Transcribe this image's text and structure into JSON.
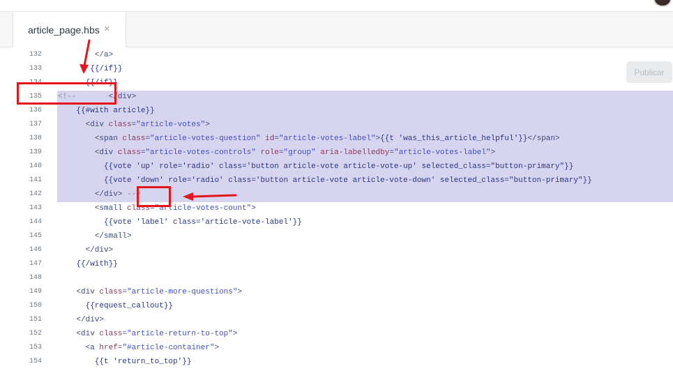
{
  "tab": {
    "filename": "article_page.hbs",
    "close_glyph": "×"
  },
  "toolbar": {
    "publish_label": "Publicar"
  },
  "editor": {
    "highlight_color": "#d7d4f0",
    "lines": [
      {
        "n": "132",
        "indent": 8,
        "tokens": [
          [
            "tag",
            "</a>"
          ]
        ]
      },
      {
        "n": "133",
        "indent": 7,
        "tokens": [
          [
            "hb",
            "{{/if}}"
          ]
        ]
      },
      {
        "n": "134",
        "indent": 6,
        "tokens": [
          [
            "hb",
            "{{/if}}"
          ]
        ]
      },
      {
        "n": "135",
        "indent": 0,
        "tokens": [
          [
            "cm",
            "<!--"
          ],
          [
            "plain",
            "       "
          ],
          [
            "tag",
            "</div>"
          ]
        ]
      },
      {
        "n": "136",
        "indent": 4,
        "tokens": [
          [
            "hb",
            "{{#with article}}"
          ]
        ]
      },
      {
        "n": "137",
        "indent": 6,
        "tokens": [
          [
            "tag",
            "<div "
          ],
          [
            "attr",
            "class"
          ],
          [
            "tag",
            "="
          ],
          [
            "str",
            "\"article-votes\""
          ],
          [
            "tag",
            ">"
          ]
        ]
      },
      {
        "n": "138",
        "indent": 8,
        "tokens": [
          [
            "tag",
            "<span "
          ],
          [
            "attr",
            "class"
          ],
          [
            "tag",
            "="
          ],
          [
            "str",
            "\"article-votes-question\""
          ],
          [
            "plain",
            " "
          ],
          [
            "attr",
            "id"
          ],
          [
            "tag",
            "="
          ],
          [
            "str",
            "\"article-votes-label\""
          ],
          [
            "tag",
            ">"
          ],
          [
            "hb",
            "{{t 'was_this_article_helpful'}}"
          ],
          [
            "tag",
            "</span>"
          ]
        ]
      },
      {
        "n": "139",
        "indent": 8,
        "tokens": [
          [
            "tag",
            "<div "
          ],
          [
            "attr",
            "class"
          ],
          [
            "tag",
            "="
          ],
          [
            "str",
            "\"article-votes-controls\""
          ],
          [
            "plain",
            " "
          ],
          [
            "attr",
            "role"
          ],
          [
            "tag",
            "="
          ],
          [
            "str",
            "\"group\""
          ],
          [
            "plain",
            " "
          ],
          [
            "attr",
            "aria-labelledby"
          ],
          [
            "tag",
            "="
          ],
          [
            "str",
            "\"article-votes-label\""
          ],
          [
            "tag",
            ">"
          ]
        ]
      },
      {
        "n": "140",
        "indent": 10,
        "tokens": [
          [
            "hb",
            "{{vote 'up' role='radio' class='button article-vote article-vote-up' selected_class=\"button-primary\"}}"
          ]
        ]
      },
      {
        "n": "141",
        "indent": 10,
        "tokens": [
          [
            "hb",
            "{{vote 'down' role='radio' class='button article-vote article-vote-down' selected_class=\"button-primary\"}}"
          ]
        ]
      },
      {
        "n": "142",
        "indent": 8,
        "tokens": [
          [
            "tag",
            "</div>"
          ],
          [
            "plain",
            " "
          ],
          [
            "cm",
            "-->"
          ]
        ]
      },
      {
        "n": "143",
        "indent": 8,
        "tokens": [
          [
            "tag",
            "<small "
          ],
          [
            "attr",
            "class"
          ],
          [
            "tag",
            "="
          ],
          [
            "str",
            "\"article-votes-count\""
          ],
          [
            "tag",
            ">"
          ]
        ]
      },
      {
        "n": "144",
        "indent": 10,
        "tokens": [
          [
            "hb",
            "{{vote 'label' class='article-vote-label'}}"
          ]
        ]
      },
      {
        "n": "145",
        "indent": 8,
        "tokens": [
          [
            "tag",
            "</small>"
          ]
        ]
      },
      {
        "n": "146",
        "indent": 6,
        "tokens": [
          [
            "tag",
            "</div>"
          ]
        ]
      },
      {
        "n": "147",
        "indent": 4,
        "tokens": [
          [
            "hb",
            "{{/with}}"
          ]
        ]
      },
      {
        "n": "148",
        "indent": 0,
        "tokens": []
      },
      {
        "n": "149",
        "indent": 4,
        "tokens": [
          [
            "tag",
            "<div "
          ],
          [
            "attr",
            "class"
          ],
          [
            "tag",
            "="
          ],
          [
            "str",
            "\"article-more-questions\""
          ],
          [
            "tag",
            ">"
          ]
        ]
      },
      {
        "n": "150",
        "indent": 6,
        "tokens": [
          [
            "hb",
            "{{request_callout}}"
          ]
        ]
      },
      {
        "n": "151",
        "indent": 4,
        "tokens": [
          [
            "tag",
            "</div>"
          ]
        ]
      },
      {
        "n": "152",
        "indent": 4,
        "tokens": [
          [
            "tag",
            "<div "
          ],
          [
            "attr",
            "class"
          ],
          [
            "tag",
            "="
          ],
          [
            "str",
            "\"article-return-to-top\""
          ],
          [
            "tag",
            ">"
          ]
        ]
      },
      {
        "n": "153",
        "indent": 6,
        "tokens": [
          [
            "tag",
            "<a "
          ],
          [
            "attr",
            "href"
          ],
          [
            "tag",
            "="
          ],
          [
            "str",
            "\"#article-container\""
          ],
          [
            "tag",
            ">"
          ]
        ]
      },
      {
        "n": "154",
        "indent": 8,
        "tokens": [
          [
            "hb",
            "{{t 'return_to_top'}}"
          ]
        ]
      }
    ]
  },
  "annotations": {
    "color": "#e3141b"
  }
}
